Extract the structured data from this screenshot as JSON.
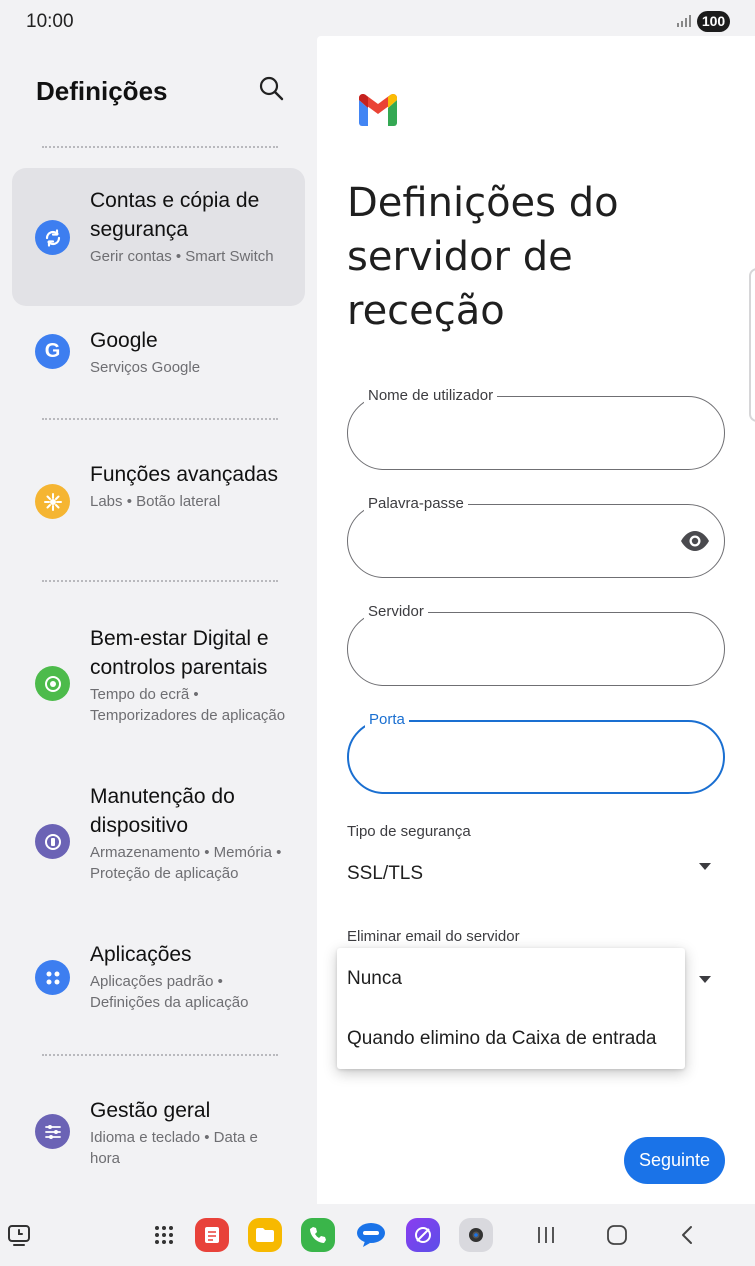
{
  "status_bar": {
    "time": "10:00",
    "battery": "100"
  },
  "settings": {
    "title": "Definições",
    "items": [
      {
        "title": "Contas e cópia de segurança",
        "subtitle": "Gerir contas • Smart Switch",
        "icon": "sync-icon",
        "color": "#3d7ef0",
        "selected": true
      },
      {
        "title": "Google",
        "subtitle": "Serviços Google",
        "icon": "google-icon",
        "color": "#3d7ef0"
      },
      {
        "title": "Funções avançadas",
        "subtitle": "Labs • Botão lateral",
        "icon": "puzzle-icon",
        "color": "#f5b532"
      },
      {
        "title": "Bem-estar Digital e controlos parentais",
        "subtitle": "Tempo do ecrã • Temporizadores de aplicação",
        "icon": "wellbeing-icon",
        "color": "#4dbb4b"
      },
      {
        "title": "Manutenção do dispositivo",
        "subtitle": "Armazenamento • Memória • Proteção de aplicação",
        "icon": "device-care-icon",
        "color": "#6b63b5"
      },
      {
        "title": "Aplicações",
        "subtitle": "Aplicações padrão • Definições da aplicação",
        "icon": "apps-icon",
        "color": "#3d7ef0"
      },
      {
        "title": "Gestão geral",
        "subtitle": "Idioma e teclado • Data e hora",
        "icon": "sliders-icon",
        "color": "#6b63b5"
      }
    ]
  },
  "gmail": {
    "heading": "Definições do servidor de receção",
    "fields": {
      "username": {
        "label": "Nome de utilizador",
        "value": ""
      },
      "password": {
        "label": "Palavra-passe",
        "value": ""
      },
      "server": {
        "label": "Servidor",
        "value": ""
      },
      "port": {
        "label": "Porta",
        "value": ""
      }
    },
    "security_type": {
      "label": "Tipo de segurança",
      "value": "SSL/TLS"
    },
    "delete_email": {
      "label": "Eliminar email do servidor",
      "options": [
        "Nunca",
        "Quando elimino da Caixa de entrada"
      ]
    },
    "next_button": "Seguinte"
  },
  "taskbar": {
    "apps": [
      "app-drawer-icon",
      "notes-app-icon",
      "my-files-app-icon",
      "phone-app-icon",
      "messages-app-icon",
      "internet-app-icon",
      "camera-app-icon"
    ],
    "colors": {
      "accent": "#1a73e8",
      "focus": "#1a6fd1"
    }
  }
}
